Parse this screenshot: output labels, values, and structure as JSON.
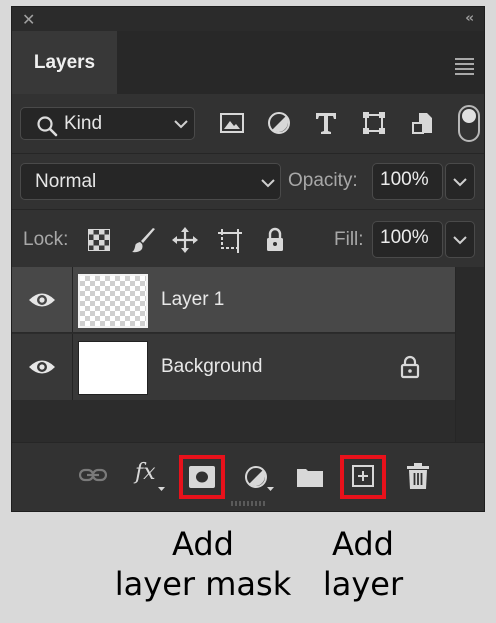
{
  "panel": {
    "tab_label": "Layers",
    "icons": {
      "close": "close-icon",
      "collapse": "double-chevron-icon",
      "menu": "panel-menu-icon"
    }
  },
  "filter": {
    "kind_label": "Kind",
    "icons": [
      "image-filter-icon",
      "adjustment-filter-icon",
      "type-filter-icon",
      "shape-filter-icon",
      "smart-object-filter-icon"
    ]
  },
  "blend": {
    "mode": "Normal",
    "opacity_label": "Opacity:",
    "opacity_value": "100%"
  },
  "lock": {
    "label": "Lock:",
    "icons": [
      "lock-transparent-pixels-icon",
      "lock-image-pixels-icon",
      "lock-position-icon",
      "lock-artboard-icon",
      "lock-all-icon"
    ],
    "fill_label": "Fill:",
    "fill_value": "100%"
  },
  "layers": [
    {
      "name": "Layer 1",
      "visible": true,
      "selected": true,
      "locked": false,
      "thumbnail": "transparent"
    },
    {
      "name": "Background",
      "visible": true,
      "selected": false,
      "locked": true,
      "thumbnail": "white"
    }
  ],
  "bottom_toolbar": {
    "icons": [
      "link-icon",
      "fx-icon",
      "add-mask-icon",
      "adjustment-layer-icon",
      "group-folder-icon",
      "new-layer-icon",
      "trash-icon"
    ],
    "fx_label": "fx",
    "highlighted": [
      "add-mask-icon",
      "new-layer-icon"
    ],
    "highlight_color": "#e8111b"
  },
  "captions": {
    "add_mask_line1": "Add",
    "add_mask_line2": "layer mask",
    "add_layer_line1": "Add",
    "add_layer_line2": "layer"
  }
}
